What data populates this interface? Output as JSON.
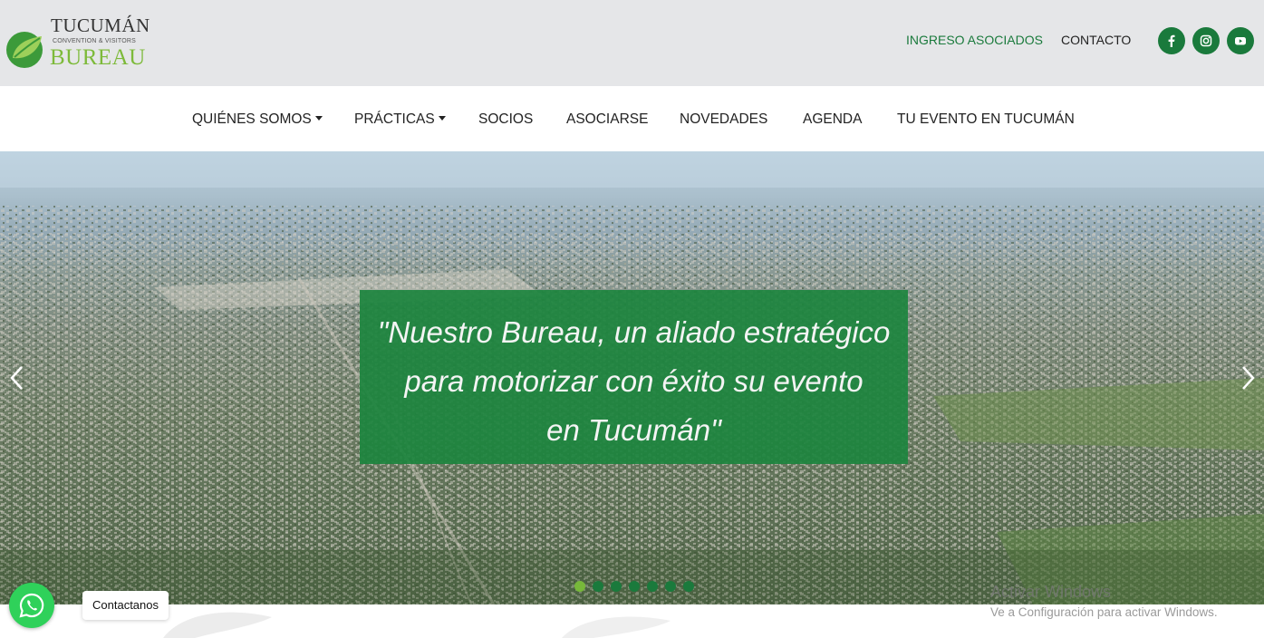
{
  "brand": {
    "line1": "TUCUMÁN",
    "line2": "CONVENTION & VISITORS",
    "line3": "BUREAU",
    "accent": "#7dba3a",
    "primary": "#1a7a3c"
  },
  "top": {
    "login": "INGRESO ASOCIADOS",
    "contact": "CONTACTO",
    "social": [
      "facebook-icon",
      "instagram-icon",
      "youtube-icon"
    ]
  },
  "nav": {
    "items": [
      {
        "label": "QUIÉNES SOMOS",
        "dropdown": true
      },
      {
        "label": "PRÁCTICAS",
        "dropdown": true
      },
      {
        "label": "SOCIOS",
        "dropdown": false
      },
      {
        "label": "ASOCIARSE",
        "dropdown": false
      },
      {
        "label": "NOVEDADES",
        "dropdown": false
      },
      {
        "label": "AGENDA",
        "dropdown": false
      },
      {
        "label": "TU EVENTO EN TUCUMÁN",
        "dropdown": false
      }
    ]
  },
  "hero": {
    "quote_lines": [
      "\"Nuestro Bureau, un aliado estratégico",
      "para motorizar con éxito su evento",
      "en Tucumán\""
    ],
    "slide_count": 7,
    "active_slide": 1
  },
  "whatsapp": {
    "label": "Contactanos"
  },
  "watermark": {
    "title": "Activar Windows",
    "subtitle": "Ve a Configuración para activar Windows."
  }
}
